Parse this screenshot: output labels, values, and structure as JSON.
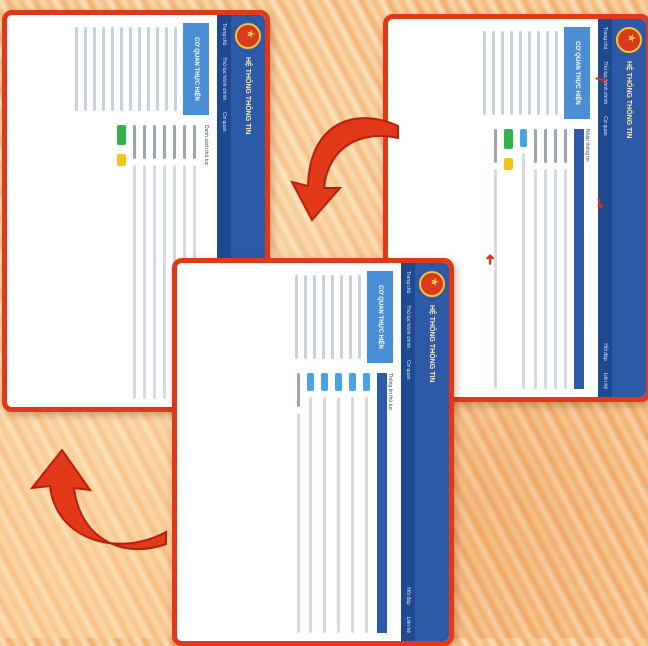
{
  "screens": [
    {
      "header_title": "HỆ THỐNG THÔNG TIN",
      "side_heading": "CƠ QUAN THỰC HIỆN",
      "tag": "Nhập thông tin"
    },
    {
      "header_title": "HỆ THỐNG THÔNG TIN",
      "side_heading": "CƠ QUAN THỰC HIỆN",
      "tag": "Danh sách thủ tục"
    },
    {
      "header_title": "HỆ THỐNG THÔNG TIN",
      "side_heading": "CƠ QUAN THỰC HIỆN",
      "tag": "Thông tin thủ tục"
    }
  ],
  "nav_items": [
    "Trang chủ",
    "Thủ tục hành chính",
    "Cơ quan",
    "Hỏi đáp",
    "Liên hệ"
  ],
  "accent_colors": {
    "frame": "#e2381a",
    "header": "#2d5aa6",
    "button_green": "#33b24a",
    "button_yellow": "#f0c419"
  },
  "icons": [
    "national-emblem-icon",
    "curved-red-arrow-icon",
    "red-pointer-arrow-icon"
  ]
}
